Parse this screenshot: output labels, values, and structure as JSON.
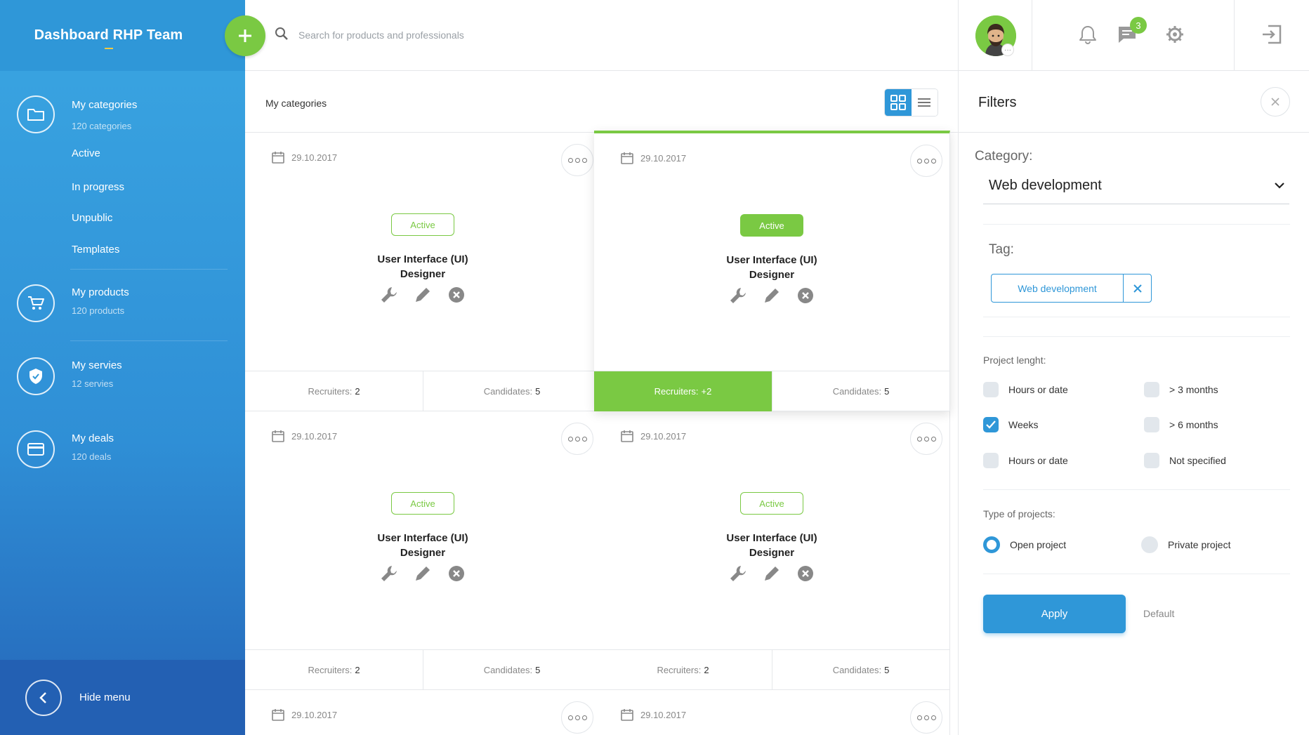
{
  "app": {
    "title": "Dashboard RHP Team"
  },
  "search": {
    "placeholder": "Search for products and professionals"
  },
  "header": {
    "notifications_badge": "3",
    "avatar_more": "···"
  },
  "sidebar": {
    "categories": {
      "title": "My categories",
      "sub": "120 categories",
      "children": [
        "Active",
        "In progress",
        "Unpublic",
        "Templates"
      ]
    },
    "products": {
      "title": "My products",
      "sub": "120 products"
    },
    "services": {
      "title": "My servies",
      "sub": "12 servies"
    },
    "deals": {
      "title": "My deals",
      "sub": "120 deals"
    },
    "hide_menu": "Hide menu"
  },
  "main": {
    "title": "My categories",
    "cards": [
      {
        "date": "29.10.2017",
        "status": "Active",
        "title_line1": "User Interface (UI)",
        "title_line2": "Designer",
        "recruiters_label": "Recruiters:",
        "recruiters": "2",
        "candidates_label": "Candidates:",
        "candidates": "5"
      },
      {
        "date": "29.10.2017",
        "status": "Active",
        "title_line1": "User Interface (UI)",
        "title_line2": "Designer",
        "recruiters_label": "Recruiters:",
        "recruiters": "+2",
        "candidates_label": "Candidates:",
        "candidates": "5"
      },
      {
        "date": "29.10.2017",
        "status": "Active",
        "title_line1": "User Interface (UI)",
        "title_line2": "Designer",
        "recruiters_label": "Recruiters:",
        "recruiters": "2",
        "candidates_label": "Candidates:",
        "candidates": "5"
      },
      {
        "date": "29.10.2017",
        "status": "Active",
        "title_line1": "User Interface (UI)",
        "title_line2": "Designer",
        "recruiters_label": "Recruiters:",
        "recruiters": "2",
        "candidates_label": "Candidates:",
        "candidates": "5"
      },
      {
        "date": "29.10.2017"
      },
      {
        "date": "29.10.2017"
      }
    ]
  },
  "filters": {
    "title": "Filters",
    "category_label": "Category:",
    "category_value": "Web development",
    "tag_label": "Tag:",
    "tag_value": "Web development",
    "project_length_label": "Project lenght:",
    "length_options": [
      "Hours or date",
      "> 3 months",
      "Weeks",
      "> 6 months",
      "Hours or date",
      "Not specified"
    ],
    "type_label": "Type of projects:",
    "type_options": [
      "Open project",
      "Private project"
    ],
    "apply": "Apply",
    "default": "Default"
  },
  "colors": {
    "accent_blue": "#2f97d8",
    "accent_green": "#7ac943",
    "sidebar_dark": "#2360b3"
  }
}
